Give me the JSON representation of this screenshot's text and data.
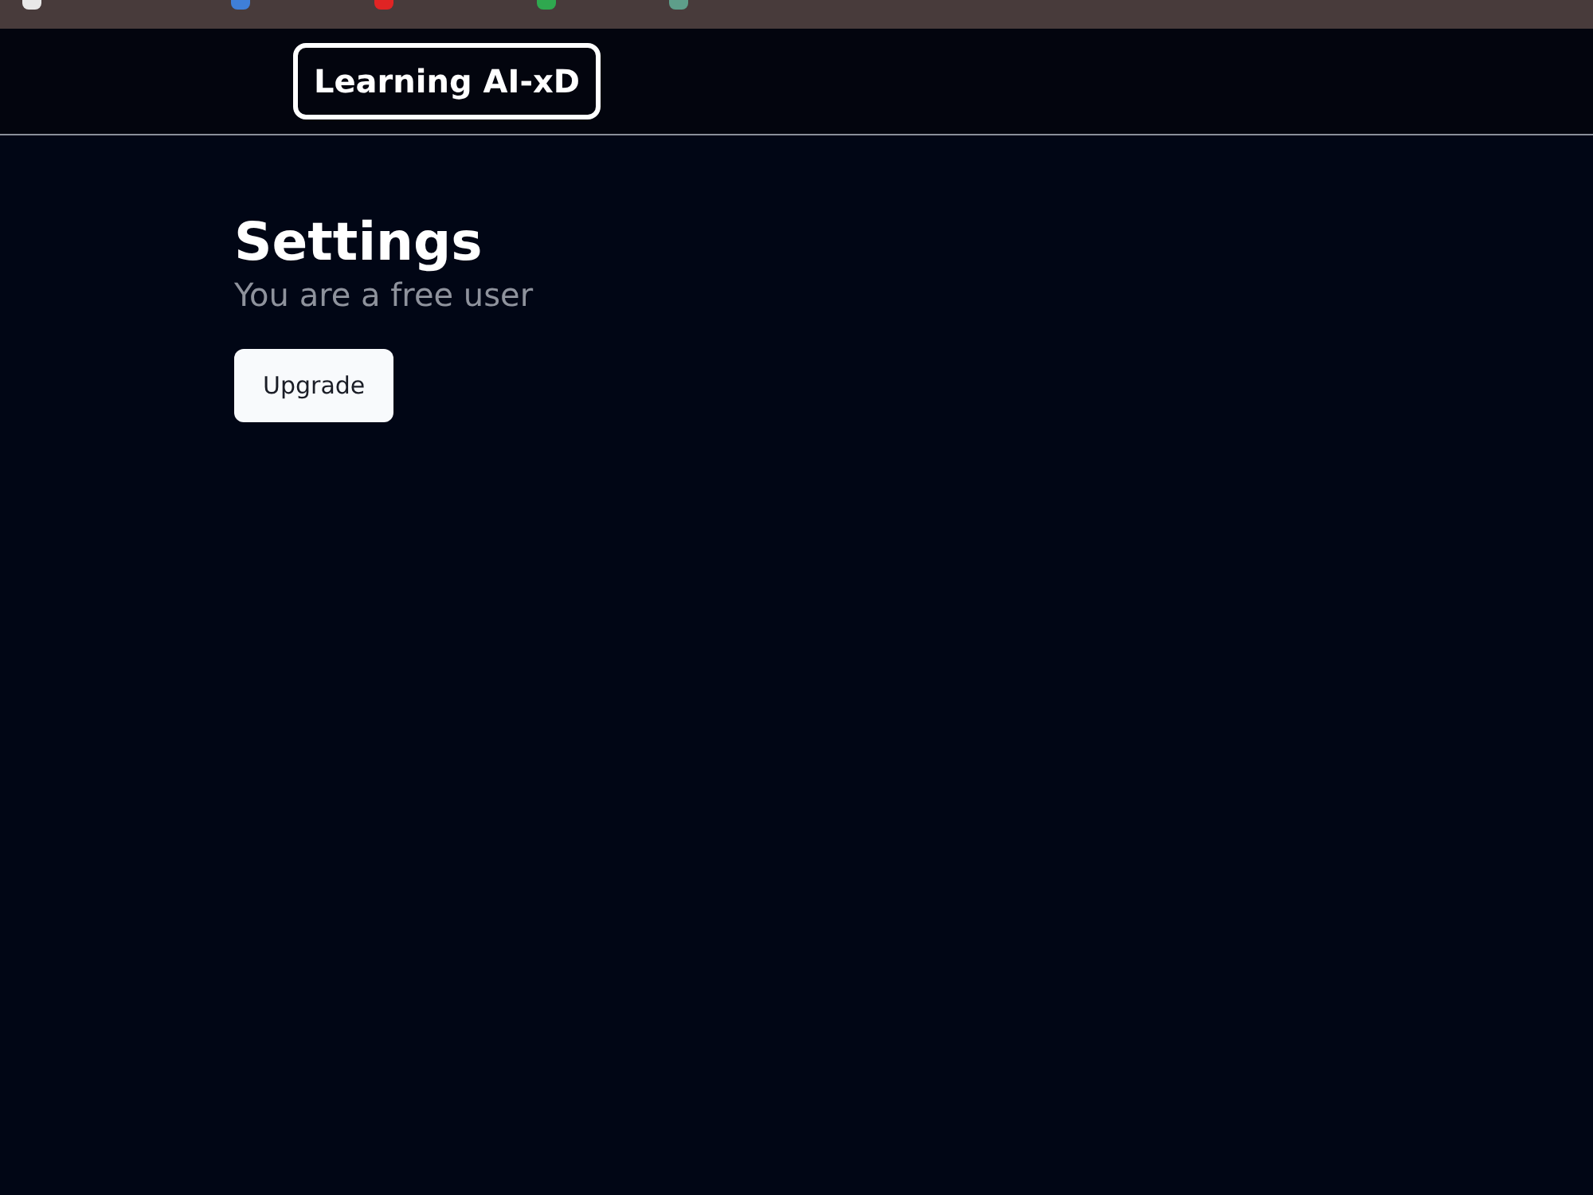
{
  "header": {
    "logo": "Learning AI-xD"
  },
  "settings": {
    "title": "Settings",
    "subtitle": "You are a free user",
    "upgrade_button": "Upgrade"
  }
}
